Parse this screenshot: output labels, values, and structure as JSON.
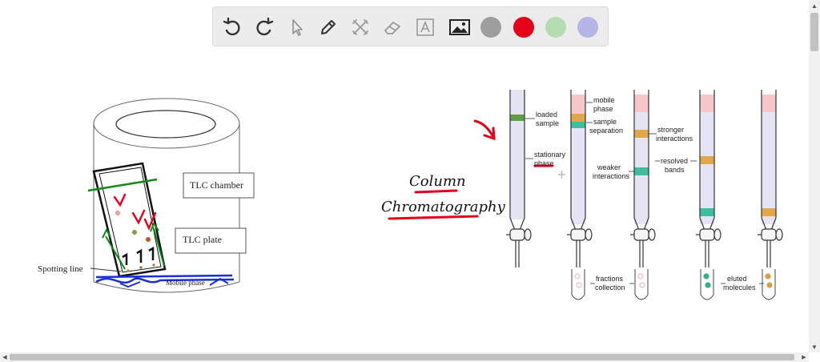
{
  "toolbar": {
    "tools": [
      {
        "name": "undo",
        "icon": "undo-icon"
      },
      {
        "name": "redo",
        "icon": "redo-icon"
      },
      {
        "name": "select",
        "icon": "cursor-icon"
      },
      {
        "name": "pen",
        "icon": "pen-icon"
      },
      {
        "name": "tools",
        "icon": "tools-icon"
      },
      {
        "name": "eraser",
        "icon": "eraser-icon"
      },
      {
        "name": "text",
        "icon": "text-icon"
      },
      {
        "name": "image",
        "icon": "image-icon"
      }
    ],
    "colors": [
      "#9e9e9e",
      "#e5001a",
      "#b5dcb0",
      "#b4b4e6"
    ]
  },
  "tlc": {
    "chamber_label": "TLC chamber",
    "plate_label": "TLC plate",
    "spotting_label": "Spotting line",
    "mobile_label": "Mobile phase"
  },
  "handwriting": {
    "line1": "Column",
    "line2": "Chromatography"
  },
  "column": {
    "loaded_sample": [
      "loaded",
      "sample"
    ],
    "stationary_phase": [
      "stationary",
      "phase"
    ],
    "mobile_phase": [
      "mobile",
      "phase"
    ],
    "sample_separation": [
      "sample",
      "separation"
    ],
    "weaker_interactions": [
      "weaker",
      "interactions"
    ],
    "stronger_interactions": [
      "stronger",
      "interactions"
    ],
    "resolved_bands": [
      "resolved",
      "bands"
    ],
    "fractions_collection": [
      "fractions",
      "collection"
    ],
    "eluted_molecules": [
      "eluted",
      "molecules"
    ]
  }
}
